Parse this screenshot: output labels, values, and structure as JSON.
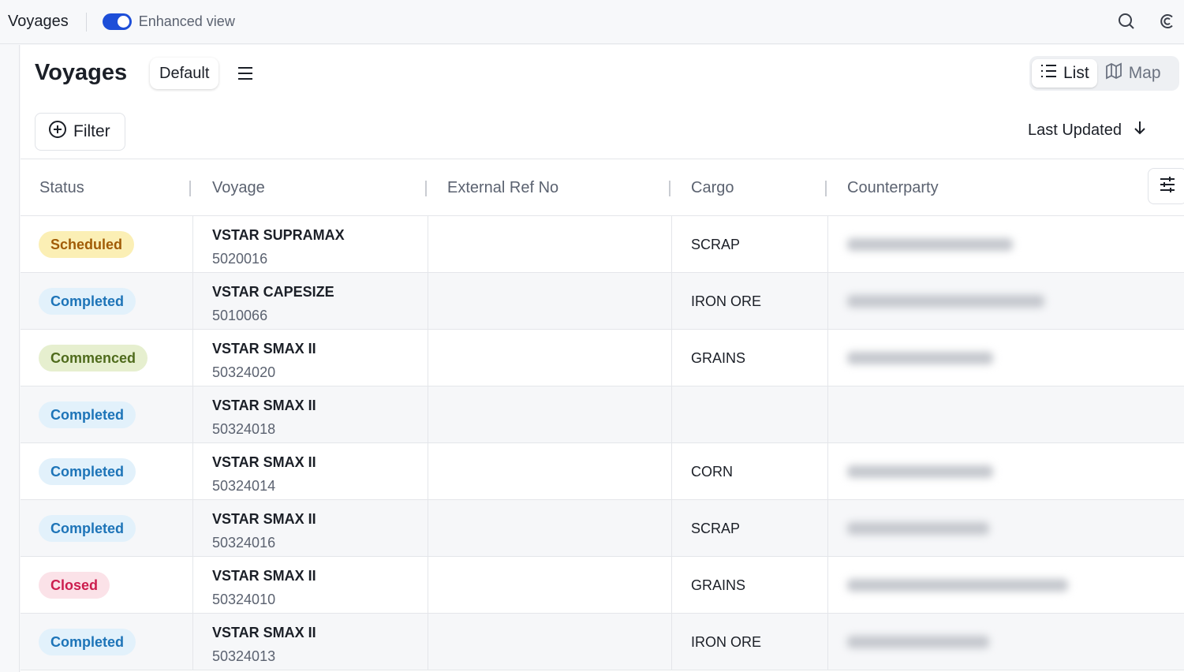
{
  "topbar": {
    "app_title": "Voyages",
    "toggle_label": "Enhanced view",
    "toggle_on": true,
    "icons": [
      "search-icon",
      "brand-logo-icon"
    ]
  },
  "page": {
    "title": "Voyages",
    "view_name": "Default",
    "view_modes": [
      {
        "label": "List",
        "icon": "list-icon",
        "active": true
      },
      {
        "label": "Map",
        "icon": "map-icon",
        "active": false
      }
    ],
    "filter_label": "Filter",
    "sort_label": "Last Updated"
  },
  "table": {
    "columns": [
      "Status",
      "Voyage",
      "External Ref No",
      "Cargo",
      "Counterparty"
    ],
    "rows": [
      {
        "status": "Scheduled",
        "voyage_name": "VSTAR SUPRAMAX",
        "voyage_code": "5020016",
        "ext_ref": "",
        "cargo": "SCRAP",
        "counterparty_redacted": true
      },
      {
        "status": "Completed",
        "voyage_name": "VSTAR CAPESIZE",
        "voyage_code": "5010066",
        "ext_ref": "",
        "cargo": "IRON ORE",
        "counterparty_redacted": true
      },
      {
        "status": "Commenced",
        "voyage_name": "VSTAR SMAX II",
        "voyage_code": "50324020",
        "ext_ref": "",
        "cargo": "GRAINS",
        "counterparty_redacted": true
      },
      {
        "status": "Completed",
        "voyage_name": "VSTAR SMAX II",
        "voyage_code": "50324018",
        "ext_ref": "",
        "cargo": "",
        "counterparty_redacted": false
      },
      {
        "status": "Completed",
        "voyage_name": "VSTAR SMAX II",
        "voyage_code": "50324014",
        "ext_ref": "",
        "cargo": "CORN",
        "counterparty_redacted": true
      },
      {
        "status": "Completed",
        "voyage_name": "VSTAR SMAX II",
        "voyage_code": "50324016",
        "ext_ref": "",
        "cargo": "SCRAP",
        "counterparty_redacted": true
      },
      {
        "status": "Closed",
        "voyage_name": "VSTAR SMAX II",
        "voyage_code": "50324010",
        "ext_ref": "",
        "cargo": "GRAINS",
        "counterparty_redacted": true
      },
      {
        "status": "Completed",
        "voyage_name": "VSTAR SMAX II",
        "voyage_code": "50324013",
        "ext_ref": "",
        "cargo": "IRON ORE",
        "counterparty_redacted": true
      }
    ]
  },
  "colors": {
    "accent": "#1d4ed8",
    "scheduled": "#a15c06",
    "completed": "#1d74b8",
    "commenced": "#4f6b1c",
    "closed": "#cc1d4e"
  }
}
